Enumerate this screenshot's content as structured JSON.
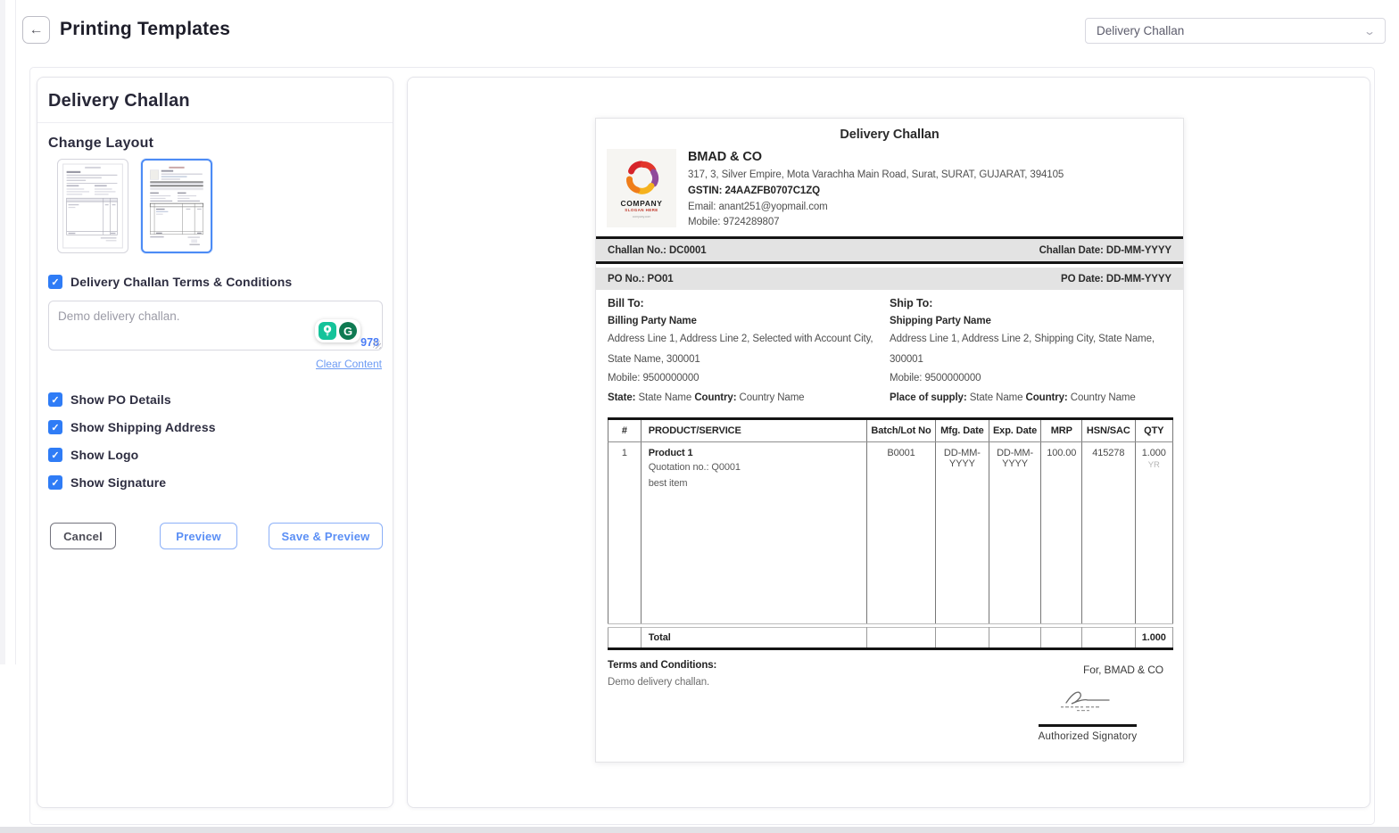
{
  "header": {
    "title": "Printing Templates",
    "back_icon": "arrow-left"
  },
  "template_select": {
    "value": "Delivery Challan",
    "chevron_icon": "chevron-down"
  },
  "colors": {
    "accent_blue": "#2f7cf6",
    "link_blue": "#6d9bf4",
    "grammarly_teal": "#15c39a",
    "count_blue": "#4a7cf6"
  },
  "panel": {
    "title": "Delivery Challan",
    "change_layout_label": "Change Layout",
    "terms_checkbox_label": "Delivery Challan Terms & Conditions",
    "terms_text": "Demo delivery challan.",
    "char_count": "978",
    "grammarly_g": "G",
    "clear_content_label": "Clear Content",
    "checkboxes": [
      "Show PO Details",
      "Show Shipping Address",
      "Show Logo",
      "Show Signature"
    ],
    "check_glyph": "✓",
    "buttons": {
      "cancel": "Cancel",
      "preview": "Preview",
      "save_preview": "Save & Preview"
    }
  },
  "document": {
    "title": "Delivery Challan",
    "company": {
      "name": "BMAD & CO",
      "address": "317, 3, Silver Empire, Mota Varachha Main Road, Surat, SURAT, GUJARAT, 394105",
      "gstin": "GSTIN: 24AAZFB0707C1ZQ",
      "email": "Email: anant251@yopmail.com",
      "mobile": "Mobile: 9724289807",
      "logo_text": "COMPANY",
      "logo_slogan": "SLOGAN HERE",
      "logo_tiny": "company.com"
    },
    "challan_no": "Challan No.: DC0001",
    "challan_date": "Challan Date: DD-MM-YYYY",
    "po_no": "PO No.: PO01",
    "po_date": "PO Date: DD-MM-YYYY",
    "bill_to": {
      "heading": "Bill To:",
      "party": "Billing Party Name",
      "address": "Address Line 1, Address Line 2, Selected with Account City, State Name, 300001",
      "mobile": "Mobile: 9500000000",
      "state_label": "State:",
      "state": "State Name",
      "country_label": "Country:",
      "country": "Country Name"
    },
    "ship_to": {
      "heading": "Ship To:",
      "party": "Shipping Party Name",
      "address": "Address Line 1, Address Line 2, Shipping City, State Name, 300001",
      "mobile": "Mobile: 9500000000",
      "pos_label": "Place of supply:",
      "state": "State Name",
      "country_label": "Country:",
      "country": "Country Name"
    },
    "table": {
      "headers": [
        "#",
        "PRODUCT/SERVICE",
        "Batch/Lot No",
        "Mfg. Date",
        "Exp. Date",
        "MRP",
        "HSN/SAC",
        "QTY"
      ],
      "row": {
        "index": "1",
        "product_name": "Product 1",
        "product_sub": "Quotation no.: Q0001",
        "product_desc": "best item",
        "batch": "B0001",
        "mfg_date": "DD-MM-YYYY",
        "exp_date": "DD-MM-YYYY",
        "mrp": "100.00",
        "hsn": "415278",
        "qty": "1.000",
        "qty_unit": "YR"
      },
      "total_label": "Total",
      "total_qty": "1.000"
    },
    "terms_heading": "Terms and Conditions:",
    "terms_text": "Demo delivery challan.",
    "signature": {
      "for_label": "For, BMAD & CO",
      "authorized_label": "Authorized Signatory"
    }
  }
}
